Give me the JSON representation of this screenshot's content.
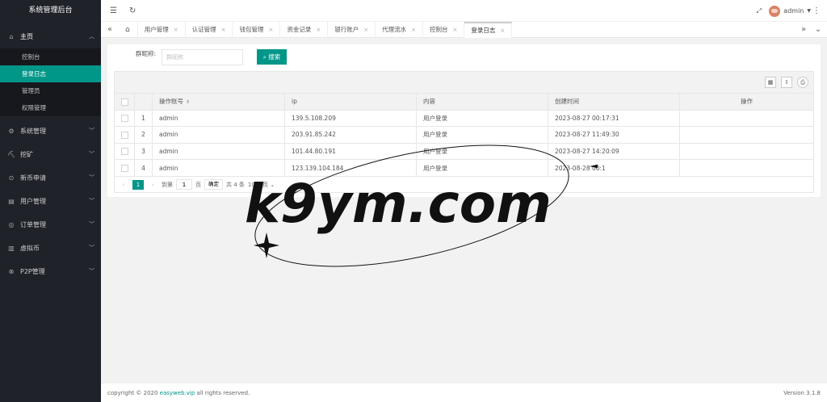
{
  "app_title": "系统管理后台",
  "sidebar": {
    "main_label": "主页",
    "sub_items": [
      "控制台",
      "登录日志",
      "管理员",
      "权限管理"
    ],
    "groups": [
      "系统管理",
      "挖矿",
      "新币申请",
      "用户管理",
      "订单管理",
      "虚拟币",
      "P2P管理"
    ]
  },
  "header": {
    "user": "admin"
  },
  "tabs": [
    "用户管理",
    "认证管理",
    "钱包管理",
    "资金记录",
    "银行账户",
    "代理流水",
    "控制台",
    "登录日志"
  ],
  "search": {
    "label": "群昵称:",
    "placeholder": "群昵称",
    "button": "搜索"
  },
  "table": {
    "headers": [
      "操作账号",
      "ip",
      "内容",
      "创建时间",
      "操作"
    ],
    "rows": [
      {
        "no": "1",
        "account": "admin",
        "ip": "139.5.108.209",
        "content": "用户登录",
        "time": "2023-08-27 00:17:31"
      },
      {
        "no": "2",
        "account": "admin",
        "ip": "203.91.85.242",
        "content": "用户登录",
        "time": "2023-08-27 11:49:30"
      },
      {
        "no": "3",
        "account": "admin",
        "ip": "101.44.80.191",
        "content": "用户登录",
        "time": "2023-08-27 14:20:09"
      },
      {
        "no": "4",
        "account": "admin",
        "ip": "123.139.104.184",
        "content": "用户登录",
        "time": "2023-08-28 00:1"
      }
    ]
  },
  "pager": {
    "current": "1",
    "goto_label": "到第",
    "page_value": "1",
    "page_unit": "页",
    "go": "确定",
    "total": "共 4 条",
    "per_page": "10条/页"
  },
  "footer": {
    "prefix": "copyright © 2020",
    "link": "easyweb.vip",
    "suffix": "all rights reserved.",
    "version": "Version 3.1.8"
  },
  "watermark": "k9ym.com",
  "colors": {
    "accent": "#009688",
    "sidebar_bg": "#20222a"
  }
}
